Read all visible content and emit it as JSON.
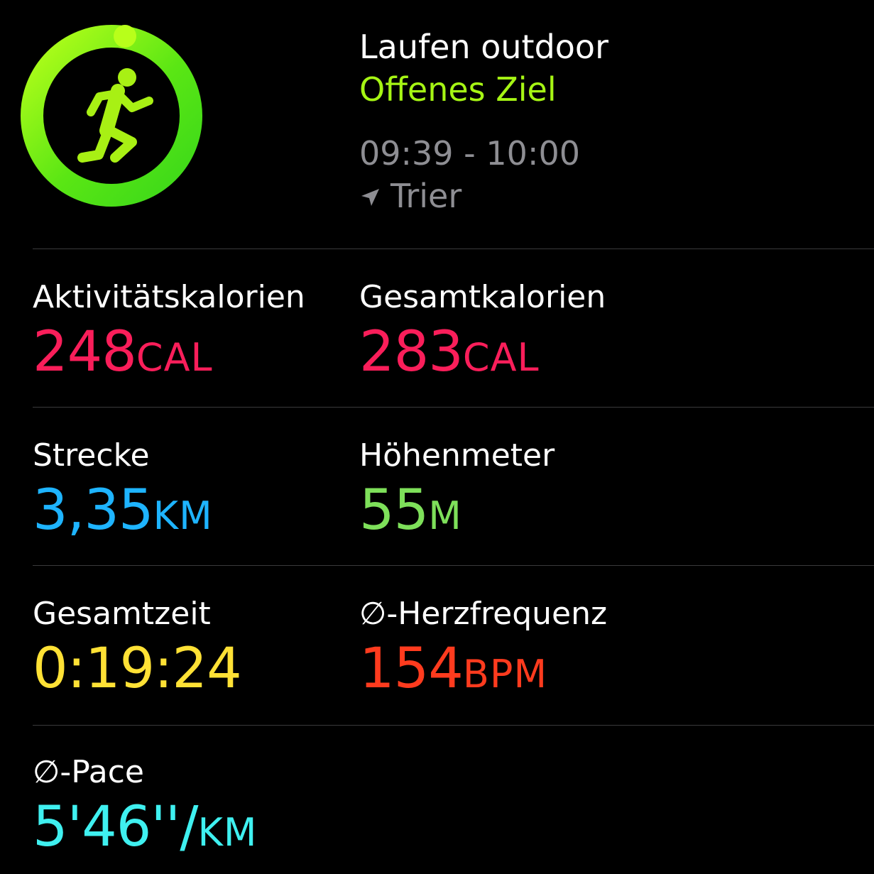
{
  "workout": {
    "title": "Laufen outdoor",
    "goal": "Offenes Ziel",
    "time_range": "09:39 - 10:00",
    "location": "Trier",
    "icon": "running-figure-icon",
    "location_icon": "location-arrow-icon"
  },
  "metrics": [
    {
      "label": "Aktivitätskalorien",
      "value": "248",
      "unit": "CAL",
      "color": "#fa1e5a"
    },
    {
      "label": "Gesamtkalorien",
      "value": "283",
      "unit": "CAL",
      "color": "#fa1e5a"
    },
    {
      "label": "Strecke",
      "value": "3,35",
      "unit": "KM",
      "color": "#1eb4ff"
    },
    {
      "label": "Höhenmeter",
      "value": "55",
      "unit": "M",
      "color": "#7ee05a"
    },
    {
      "label": "Gesamtzeit",
      "value": "0:19:24",
      "unit": "",
      "color": "#ffe135"
    },
    {
      "label": "∅-Herzfrequenz",
      "value": "154",
      "unit": "BPM",
      "color": "#ff3b1e"
    },
    {
      "label": "∅-Pace",
      "value": "5'46''/",
      "unit": "KM",
      "color": "#3ff0f0"
    }
  ],
  "colors": {
    "ring_start": "#b4ff00",
    "ring_end": "#3ad81a",
    "goal": "#a6f514",
    "secondary_text": "#8e8e93",
    "divider": "#3a3a3c"
  }
}
